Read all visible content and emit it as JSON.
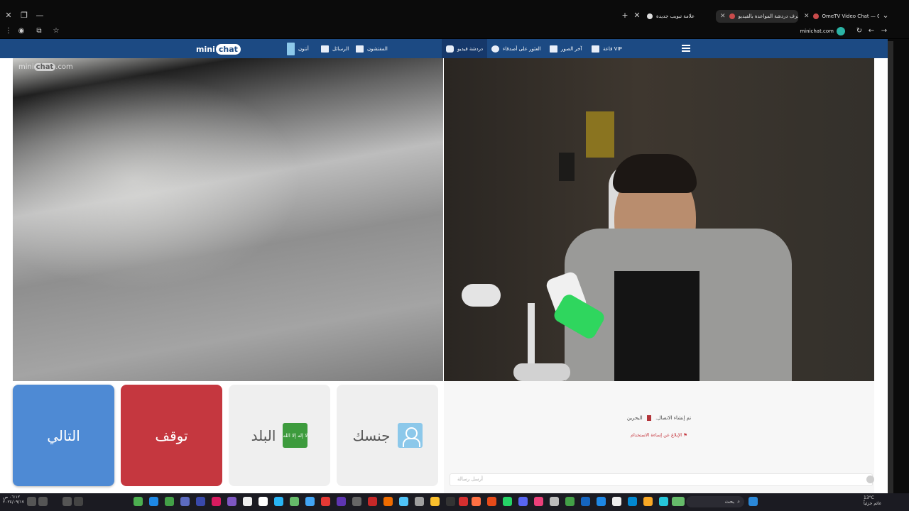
{
  "browser": {
    "tabs": [
      {
        "title": "OmeTV Video Chat — Ome",
        "active": false
      },
      {
        "title": "غرف دردشة المواعدة بالفيديو",
        "active": true
      },
      {
        "title": "علامة تبويب جديدة",
        "active": false
      }
    ],
    "url": "minichat.com"
  },
  "site": {
    "logo_mini": "mini",
    "logo_chat": "chat",
    "nav": {
      "video_chat": "دردشة فيديو",
      "search": "العثور على أصدقاء",
      "latest_photos": "آخر الصور",
      "vip": "قاعة VIP",
      "inspectors": "المفتشون",
      "messages": "الرسائل",
      "profile": "أنتون"
    },
    "watermark": {
      "mini": "mini",
      "chat": "chat",
      "com": ".com"
    }
  },
  "controls": {
    "next": "التالي",
    "stop": "توقف",
    "country": "البلد",
    "gender": "جنسك",
    "country_flag_text": "لا إله إلا الله"
  },
  "chat": {
    "status": "تم إنشاء الاتصال.",
    "country": "البحرين",
    "report": "الإبلاغ عن إساءة الاستخدام",
    "placeholder": "أرسل رسالة"
  },
  "taskbar": {
    "search": "بحث",
    "time": "٠٦:١٢ ص",
    "date": "٢٠٢٤/٠٩/١٧",
    "weather_temp": "13°C",
    "weather_desc": "غائم جزئياً"
  },
  "colors": {
    "navbar": "#1c4a83",
    "next": "#4e8ad4",
    "stop": "#c5373f",
    "neutral_btn": "#efefef"
  }
}
